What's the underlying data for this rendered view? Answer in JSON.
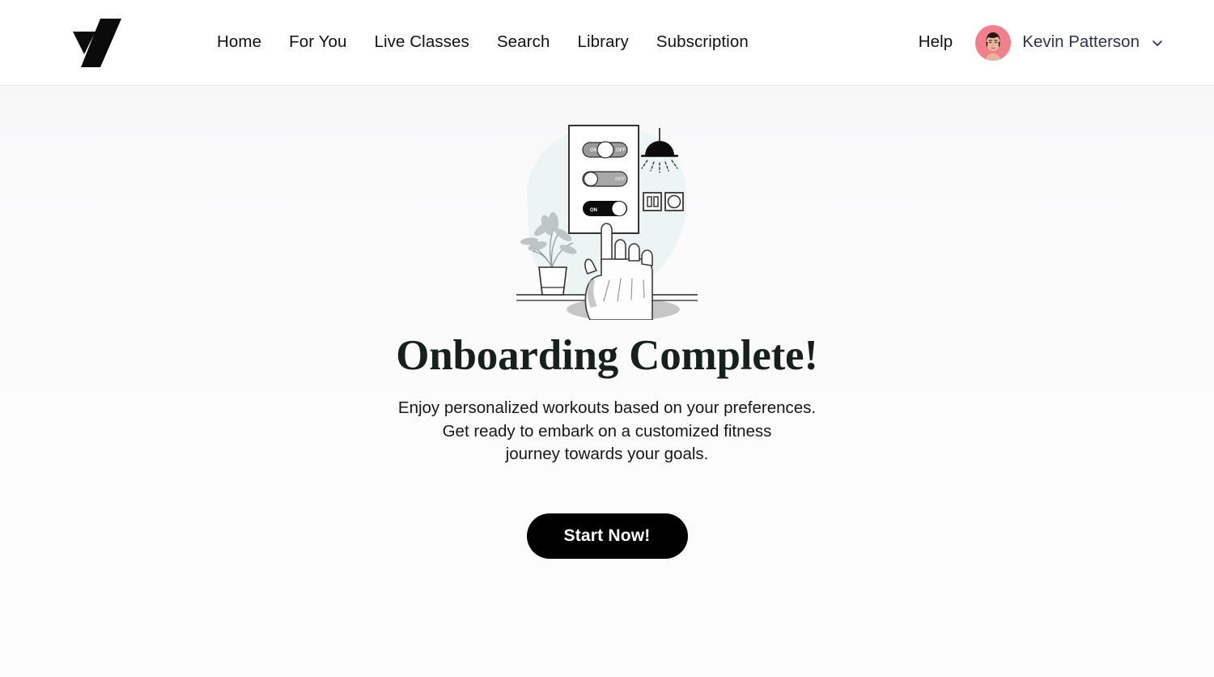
{
  "header": {
    "logo_name": "brand-checkmark-logo",
    "nav": [
      {
        "label": "Home"
      },
      {
        "label": "For You"
      },
      {
        "label": "Live Classes"
      },
      {
        "label": "Search"
      },
      {
        "label": "Library"
      },
      {
        "label": "Subscription"
      }
    ],
    "help_label": "Help",
    "user": {
      "name": "Kevin Patterson",
      "avatar_name": "user-avatar",
      "avatar_bg": "#f2808c",
      "chevron_name": "chevron-down-icon"
    }
  },
  "main": {
    "illustration": {
      "name": "smart-switch-panel-illustration",
      "blob_color": "#edf4f4",
      "toggles": [
        {
          "state": "mid",
          "on_label": "ON",
          "off_label": "OFF",
          "track": "#9a9a9a"
        },
        {
          "state": "off",
          "off_label": "OFF",
          "track": "#a8a8a8"
        },
        {
          "state": "on",
          "on_label": "ON",
          "track": "#000000"
        }
      ]
    },
    "headline": "Onboarding Complete!",
    "subtext_line1": "Enjoy personalized workouts based on your preferences.",
    "subtext_line2": "Get ready to embark on a customized fitness",
    "subtext_line3": "journey towards your goals.",
    "cta_label": "Start Now!"
  },
  "colors": {
    "accent": "#000000",
    "heading": "#16211e",
    "username": "#2a3347",
    "page_bg": "#fbfbfc",
    "header_bg": "#ffffff"
  }
}
